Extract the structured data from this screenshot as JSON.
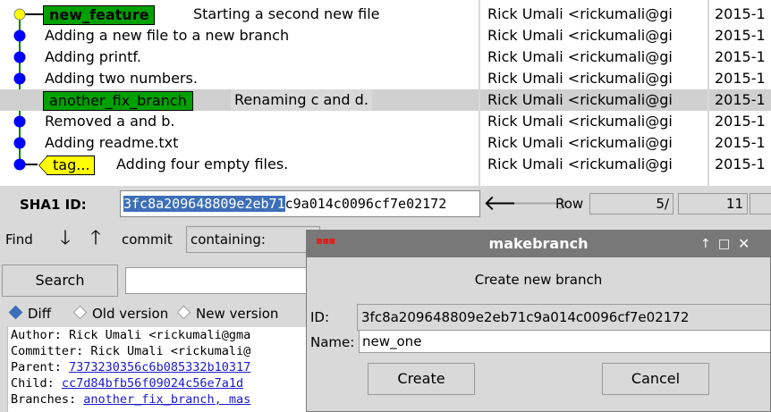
{
  "commits": [
    {
      "ref": "new_feature",
      "ref_style": "head",
      "message": "Starting a second new file",
      "author": "Rick Umali <rickumali@gi",
      "date": "2015-1"
    },
    {
      "ref": "",
      "message": "Adding a new file to a new branch",
      "author": "Rick Umali <rickumali@gi",
      "date": "2015-1"
    },
    {
      "ref": "",
      "message": "Adding printf.",
      "author": "Rick Umali <rickumali@gi",
      "date": "2015-1"
    },
    {
      "ref": "",
      "message": "Adding two numbers.",
      "author": "Rick Umali <rickumali@gi",
      "date": "2015-1"
    },
    {
      "ref": "another_fix_branch",
      "ref_style": "branch",
      "message": "Renaming c and d.",
      "author": "Rick Umali <rickumali@gi",
      "date": "2015-1",
      "selected": true
    },
    {
      "ref": "",
      "message": "Removed a and b.",
      "author": "Rick Umali <rickumali@gi",
      "date": "2015-1"
    },
    {
      "ref": "",
      "message": "Adding readme.txt",
      "author": "Rick Umali <rickumali@gi",
      "date": "2015-1"
    },
    {
      "tag": "tag...",
      "message": "Adding four empty files.",
      "author": "Rick Umali <rickumali@gi",
      "date": "2015-1"
    }
  ],
  "graph": {
    "node_color": "#0000ff",
    "head_node_color": "#ffff00",
    "line_color": "#008000",
    "ref_bg": "#00a000",
    "tag_bg": "#ffff00"
  },
  "sha": {
    "label": "SHA1 ID:",
    "selected_part": "3fc8a209648809e2eb71",
    "rest": "c9a014c0096cf7e02172",
    "back_arrow": "🡐",
    "forward_arrow": "🡒"
  },
  "row": {
    "label": "Row",
    "current": "5",
    "separator": "/",
    "total": "11"
  },
  "find": {
    "label": "Find",
    "down_arrow": "🡓",
    "up_arrow": "🡑",
    "type": "commit",
    "mode": "containing:"
  },
  "search": {
    "button_label": "Search"
  },
  "view_options": {
    "diff": "Diff",
    "old_version": "Old version",
    "new_version": "New version",
    "selected": "diff"
  },
  "details": {
    "author": "Author: Rick Umali <rickumali@gma",
    "committer": "Committer: Rick Umali <rickumali@",
    "parent_label": "Parent: ",
    "parent_sha": "7373230356c6b085332b10317",
    "child_label": "Child:  ",
    "child_sha": "cc7d84bfb56f09024c56e7a1d",
    "branches_label": "Branches: ",
    "branches": "another_fix_branch, mas"
  },
  "dialog": {
    "icon": "▪▪▪",
    "title": "makebranch",
    "up_icon": "↑",
    "max_icon": "□",
    "close_icon": "✕",
    "heading": "Create new branch",
    "id_label": "ID:",
    "id_value": "3fc8a209648809e2eb71c9a014c0096cf7e02172",
    "name_label": "Name:",
    "name_value": "new_one",
    "create_label": "Create",
    "cancel_label": "Cancel"
  }
}
